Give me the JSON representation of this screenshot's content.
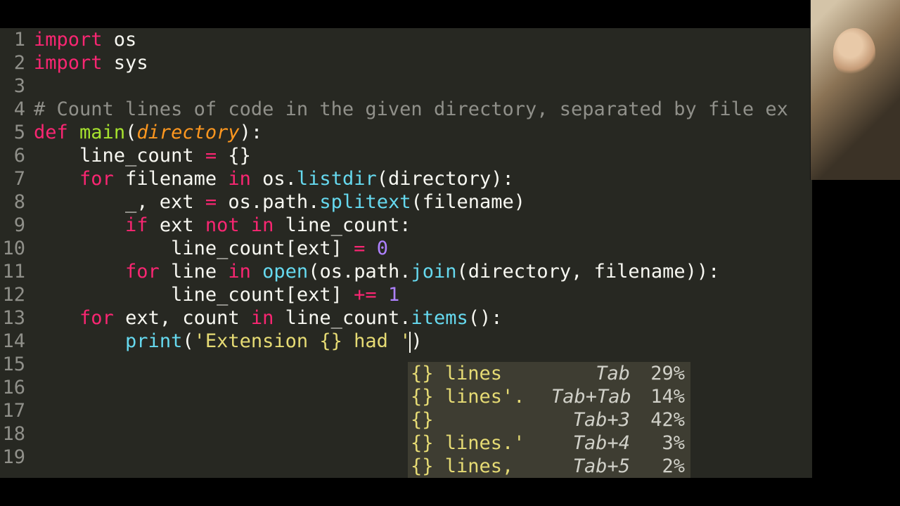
{
  "editor": {
    "lines": [
      {
        "n": "1",
        "tokens": [
          {
            "c": "kw",
            "t": "import"
          },
          {
            "c": "var",
            "t": " os"
          }
        ]
      },
      {
        "n": "2",
        "tokens": [
          {
            "c": "kw",
            "t": "import"
          },
          {
            "c": "var",
            "t": " sys"
          }
        ]
      },
      {
        "n": "3",
        "tokens": []
      },
      {
        "n": "4",
        "tokens": [
          {
            "c": "cmt",
            "t": "# Count lines of code in the given directory, separated by file ex"
          }
        ]
      },
      {
        "n": "5",
        "tokens": [
          {
            "c": "kw",
            "t": "def"
          },
          {
            "c": "var",
            "t": " "
          },
          {
            "c": "fn",
            "t": "main"
          },
          {
            "c": "var",
            "t": "("
          },
          {
            "c": "arg",
            "t": "directory"
          },
          {
            "c": "var",
            "t": "):"
          }
        ]
      },
      {
        "n": "6",
        "tokens": [
          {
            "c": "var",
            "t": "    line_count "
          },
          {
            "c": "op",
            "t": "="
          },
          {
            "c": "var",
            "t": " {}"
          }
        ]
      },
      {
        "n": "7",
        "tokens": [
          {
            "c": "var",
            "t": "    "
          },
          {
            "c": "kw",
            "t": "for"
          },
          {
            "c": "var",
            "t": " filename "
          },
          {
            "c": "kw",
            "t": "in"
          },
          {
            "c": "var",
            "t": " os."
          },
          {
            "c": "meth",
            "t": "listdir"
          },
          {
            "c": "var",
            "t": "(directory):"
          }
        ]
      },
      {
        "n": "8",
        "tokens": [
          {
            "c": "var",
            "t": "        _, ext "
          },
          {
            "c": "op",
            "t": "="
          },
          {
            "c": "var",
            "t": " os.path."
          },
          {
            "c": "meth",
            "t": "splitext"
          },
          {
            "c": "var",
            "t": "(filename)"
          }
        ]
      },
      {
        "n": "9",
        "tokens": [
          {
            "c": "var",
            "t": "        "
          },
          {
            "c": "kw",
            "t": "if"
          },
          {
            "c": "var",
            "t": " ext "
          },
          {
            "c": "kw",
            "t": "not in"
          },
          {
            "c": "var",
            "t": " line_count:"
          }
        ]
      },
      {
        "n": "10",
        "tokens": [
          {
            "c": "var",
            "t": "            line_count[ext] "
          },
          {
            "c": "op",
            "t": "="
          },
          {
            "c": "var",
            "t": " "
          },
          {
            "c": "num",
            "t": "0"
          }
        ]
      },
      {
        "n": "11",
        "tokens": [
          {
            "c": "var",
            "t": "        "
          },
          {
            "c": "kw",
            "t": "for"
          },
          {
            "c": "var",
            "t": " line "
          },
          {
            "c": "kw",
            "t": "in"
          },
          {
            "c": "var",
            "t": " "
          },
          {
            "c": "call",
            "t": "open"
          },
          {
            "c": "var",
            "t": "(os.path."
          },
          {
            "c": "meth",
            "t": "join"
          },
          {
            "c": "var",
            "t": "(directory, filename)):"
          }
        ]
      },
      {
        "n": "12",
        "tokens": [
          {
            "c": "var",
            "t": "            line_count[ext] "
          },
          {
            "c": "op",
            "t": "+="
          },
          {
            "c": "var",
            "t": " "
          },
          {
            "c": "num",
            "t": "1"
          }
        ]
      },
      {
        "n": "13",
        "tokens": [
          {
            "c": "var",
            "t": "    "
          },
          {
            "c": "kw",
            "t": "for"
          },
          {
            "c": "var",
            "t": " ext, count "
          },
          {
            "c": "kw",
            "t": "in"
          },
          {
            "c": "var",
            "t": " line_count."
          },
          {
            "c": "meth",
            "t": "items"
          },
          {
            "c": "var",
            "t": "():"
          }
        ]
      },
      {
        "n": "14",
        "tokens": [
          {
            "c": "var",
            "t": "        "
          },
          {
            "c": "call",
            "t": "print"
          },
          {
            "c": "var",
            "t": "("
          },
          {
            "c": "str",
            "t": "'Extension {} had '"
          },
          {
            "c": "var",
            "t": ")"
          }
        ]
      },
      {
        "n": "15",
        "tokens": []
      },
      {
        "n": "16",
        "tokens": []
      },
      {
        "n": "17",
        "tokens": []
      },
      {
        "n": "18",
        "tokens": []
      },
      {
        "n": "19",
        "tokens": []
      }
    ]
  },
  "suggestions": [
    {
      "completion": "{} lines",
      "key": "Tab",
      "pct": "29%"
    },
    {
      "completion": "{} lines'.",
      "key": "Tab+Tab",
      "pct": "14%"
    },
    {
      "completion": "{}",
      "key": "Tab+3",
      "pct": "42%"
    },
    {
      "completion": "{} lines.'",
      "key": "Tab+4",
      "pct": "3%"
    },
    {
      "completion": "{} lines,",
      "key": "Tab+5",
      "pct": "2%"
    }
  ]
}
